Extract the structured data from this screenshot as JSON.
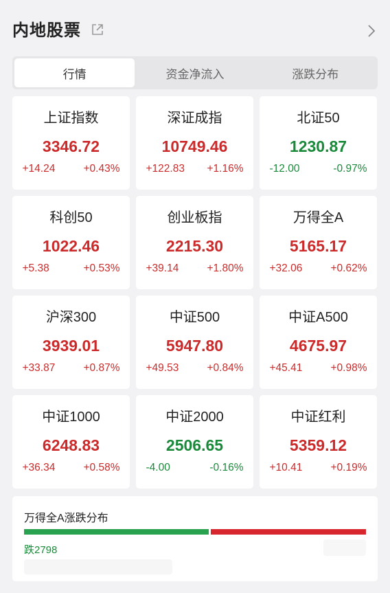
{
  "header": {
    "title": "内地股票",
    "external_icon": "external-link-icon",
    "more_icon": "chevron-right-icon"
  },
  "tabs": [
    {
      "label": "行情",
      "active": true
    },
    {
      "label": "资金净流入",
      "active": false
    },
    {
      "label": "涨跌分布",
      "active": false
    }
  ],
  "colors": {
    "up": "#cc2a2a",
    "down": "#1a8a3a",
    "bar_green": "#29a24f",
    "bar_red": "#d8262e"
  },
  "indices": [
    {
      "name": "上证指数",
      "price": "3346.72",
      "change": "+14.24",
      "pct": "+0.43%",
      "dir": "up"
    },
    {
      "name": "深证成指",
      "price": "10749.46",
      "change": "+122.83",
      "pct": "+1.16%",
      "dir": "up"
    },
    {
      "name": "北证50",
      "price": "1230.87",
      "change": "-12.00",
      "pct": "-0.97%",
      "dir": "down"
    },
    {
      "name": "科创50",
      "price": "1022.46",
      "change": "+5.38",
      "pct": "+0.53%",
      "dir": "up"
    },
    {
      "name": "创业板指",
      "price": "2215.30",
      "change": "+39.14",
      "pct": "+1.80%",
      "dir": "up"
    },
    {
      "name": "万得全A",
      "price": "5165.17",
      "change": "+32.06",
      "pct": "+0.62%",
      "dir": "up"
    },
    {
      "name": "沪深300",
      "price": "3939.01",
      "change": "+33.87",
      "pct": "+0.87%",
      "dir": "up"
    },
    {
      "name": "中证500",
      "price": "5947.80",
      "change": "+49.53",
      "pct": "+0.84%",
      "dir": "up"
    },
    {
      "name": "中证A500",
      "price": "4675.97",
      "change": "+45.41",
      "pct": "+0.98%",
      "dir": "up"
    },
    {
      "name": "中证1000",
      "price": "6248.83",
      "change": "+36.34",
      "pct": "+0.58%",
      "dir": "up"
    },
    {
      "name": "中证2000",
      "price": "2506.65",
      "change": "-4.00",
      "pct": "-0.16%",
      "dir": "down"
    },
    {
      "name": "中证红利",
      "price": "5359.12",
      "change": "+10.41",
      "pct": "+0.19%",
      "dir": "up"
    }
  ],
  "distribution": {
    "title": "万得全A涨跌分布",
    "fall_label": "跌2798",
    "fall_fraction": 0.54
  }
}
